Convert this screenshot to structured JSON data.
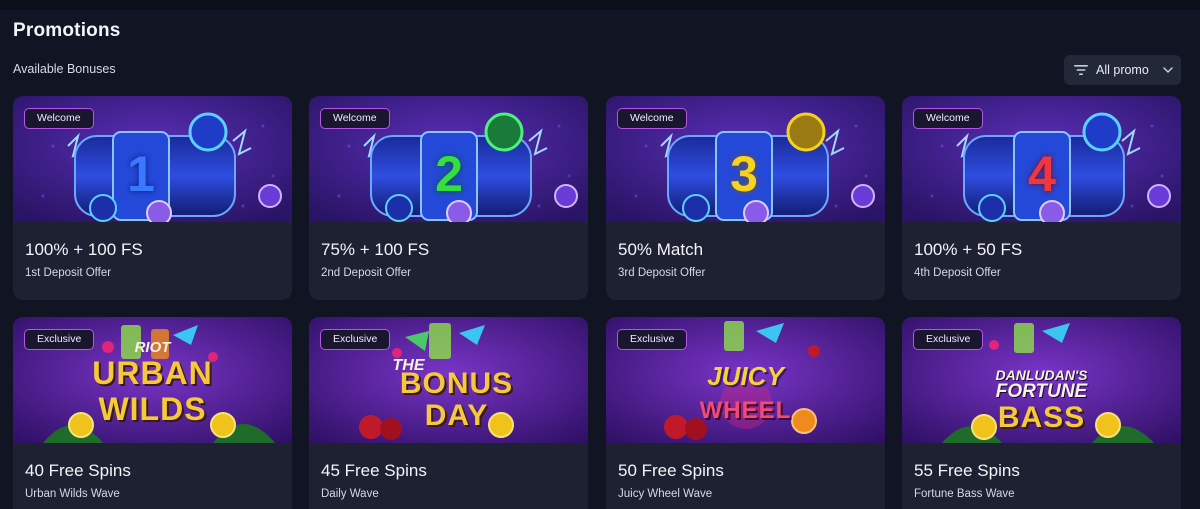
{
  "header": {
    "title": "Promotions",
    "subtitle": "Available Bonuses",
    "filter_label": "All promo"
  },
  "welcome_cards": [
    {
      "badge": "Welcome",
      "digit": "1",
      "title": "100% + 100 FS",
      "subtitle": "1st Deposit Offer",
      "digit_color": "#2f6df0"
    },
    {
      "badge": "Welcome",
      "digit": "2",
      "title": "75% + 100 FS",
      "subtitle": "2nd Deposit Offer",
      "digit_color": "#2fdc3a"
    },
    {
      "badge": "Welcome",
      "digit": "3",
      "title": "50% Match",
      "subtitle": "3rd Deposit Offer",
      "digit_color": "#f4d21c"
    },
    {
      "badge": "Welcome",
      "digit": "4",
      "title": "100% + 50 FS",
      "subtitle": "4th Deposit Offer",
      "digit_color": "#f0303a"
    }
  ],
  "exclusive_cards": [
    {
      "badge": "Exclusive",
      "logo_top": "RIOT",
      "logo_mid": "URBAN",
      "logo_bottom": "WILDS",
      "title": "40 Free Spins",
      "subtitle": "Urban Wilds Wave"
    },
    {
      "badge": "Exclusive",
      "logo_top": "THE",
      "logo_mid": "BONUS",
      "logo_bottom": "DAY",
      "title": "45 Free Spins",
      "subtitle": "Daily Wave"
    },
    {
      "badge": "Exclusive",
      "logo_top": "",
      "logo_mid": "JUICY",
      "logo_bottom": "WHEEL",
      "title": "50 Free Spins",
      "subtitle": "Juicy Wheel Wave"
    },
    {
      "badge": "Exclusive",
      "logo_top": "DANLUDAN'S",
      "logo_mid": "FORTUNE",
      "logo_bottom": "BASS",
      "title": "55 Free Spins",
      "subtitle": "Fortune Bass Wave"
    }
  ],
  "colors": {
    "page_bg": "#111422",
    "card_bg": "#1d2131",
    "badge_border": "#b356e8",
    "welcome_art_bg": "#3a1f8e",
    "exclusive_art_bg": "#4a1a8a"
  },
  "icons": {
    "filter": "filter-lines-icon",
    "dropdown": "chevron-down-icon"
  }
}
